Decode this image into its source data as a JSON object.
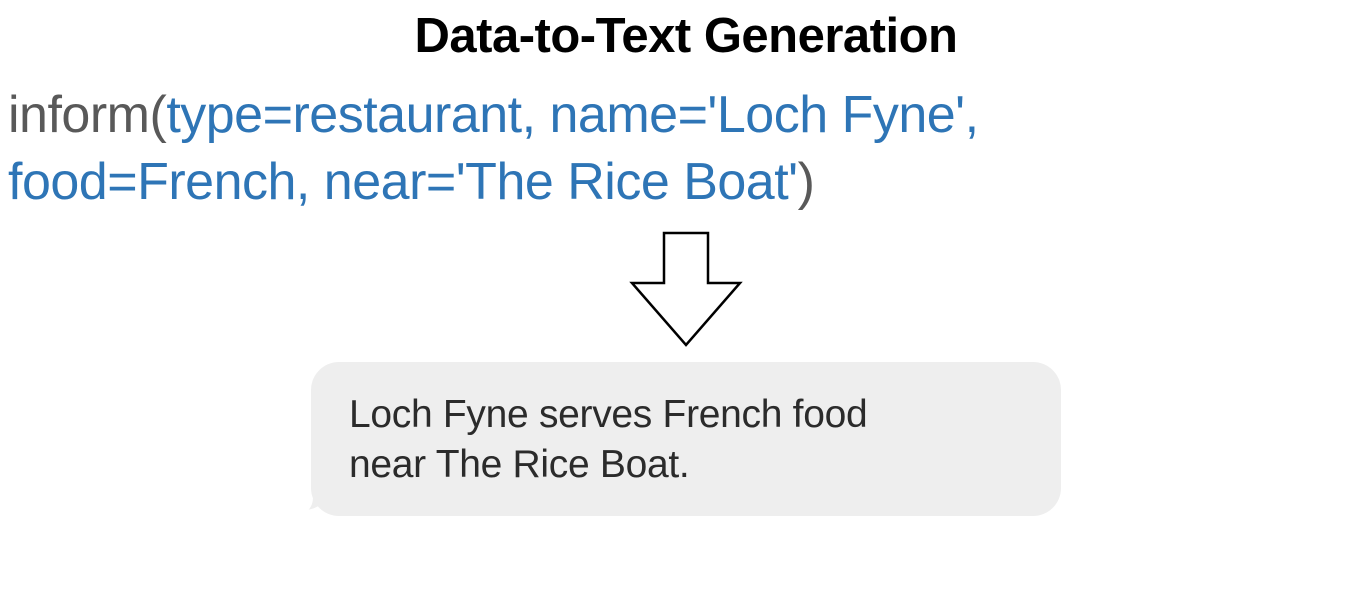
{
  "title": "Data-to-Text Generation",
  "input": {
    "func": "inform",
    "open_paren": "(",
    "args_line1": "type=restaurant, name='Loch Fyne',",
    "args_line2": "food=French, near='The Rice Boat'",
    "close_paren": ")"
  },
  "output": {
    "text_line1": "Loch Fyne serves French food",
    "text_line2": "near The Rice Boat."
  },
  "colors": {
    "title": "#000000",
    "func": "#595959",
    "args": "#2E75B6",
    "bubble_bg": "#eeeeee",
    "bubble_text": "#2b2b2b"
  }
}
